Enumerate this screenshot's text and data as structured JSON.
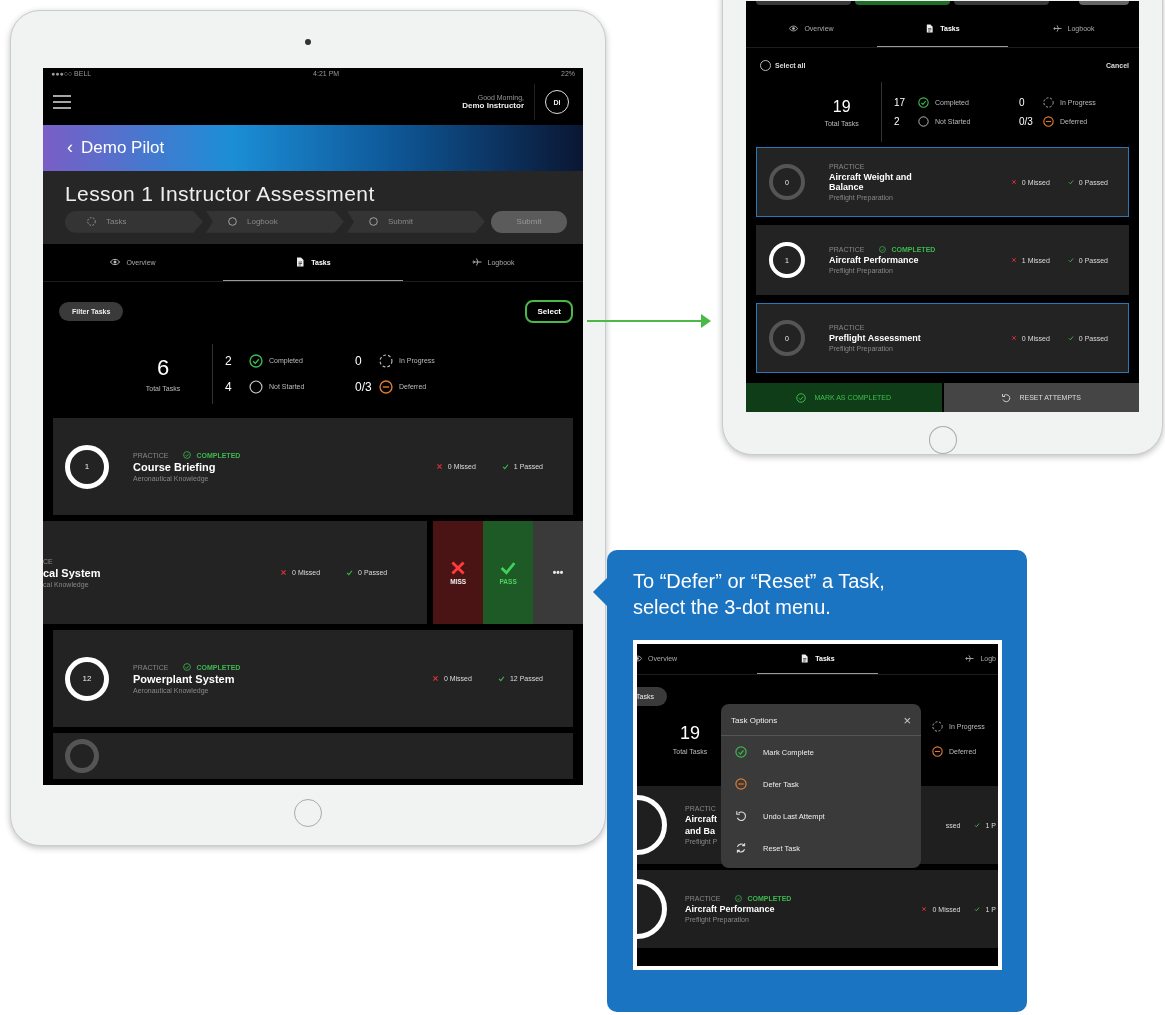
{
  "main_device": {
    "status_bar": {
      "carrier": "●●●○○ BELL",
      "time": "4:21 PM",
      "battery": "22%"
    },
    "header": {
      "greeting": "Good Morning,",
      "user": "Demo Instructor",
      "avatar": "DI"
    },
    "banner": {
      "back": "‹",
      "title": "Demo Pilot"
    },
    "lesson": {
      "title": "Lesson 1 Instructor Assessment",
      "steps": [
        {
          "label": "Tasks",
          "kind": "progress"
        },
        {
          "label": "Logbook",
          "kind": "not_started"
        },
        {
          "label": "Submit",
          "kind": "not_started"
        }
      ],
      "submit": {
        "label": "Submit",
        "disabled": true
      }
    },
    "tabs": [
      {
        "label": "Overview",
        "selected": false
      },
      {
        "label": "Tasks",
        "selected": true
      },
      {
        "label": "Logbook",
        "selected": false
      }
    ],
    "filter_button": "Filter Tasks",
    "select_button": "Select",
    "summary": {
      "total": "6",
      "total_label": "Total Tasks",
      "stats": [
        {
          "count": "2",
          "label": "Completed",
          "kind": "completed"
        },
        {
          "count": "0",
          "label": "In Progress",
          "kind": "progress"
        },
        {
          "count": "4",
          "label": "Not Started",
          "kind": "not_started"
        },
        {
          "count": "0/3",
          "label": "Deferred",
          "kind": "deferred"
        }
      ]
    },
    "tasks": [
      {
        "kind": "card",
        "count": "1",
        "completed": true,
        "type": "PRACTICE",
        "status": "COMPLETED",
        "name": "Course Briefing",
        "category": "Aeronautical Knowledge",
        "missed": "0 Missed",
        "passed": "1 Passed"
      },
      {
        "kind": "swiped",
        "type": "CE",
        "name": "cal System",
        "category": "cal Knowledge",
        "missed": "0 Missed",
        "passed": "0 Passed",
        "actions": [
          {
            "kind": "miss",
            "label": "MISS"
          },
          {
            "kind": "pass",
            "label": "PASS"
          },
          {
            "kind": "more",
            "label": "•••"
          }
        ]
      },
      {
        "kind": "card",
        "count": "12",
        "completed": true,
        "type": "PRACTICE",
        "status": "COMPLETED",
        "name": "Powerplant System",
        "category": "Aeronautical Knowledge",
        "missed": "0 Missed",
        "passed": "12 Passed"
      },
      {
        "kind": "partial",
        "completed": false
      }
    ]
  },
  "select_device": {
    "tabs": [
      {
        "label": "Overview",
        "selected": false
      },
      {
        "label": "Tasks",
        "selected": true
      },
      {
        "label": "Logbook",
        "selected": false
      }
    ],
    "select_all": {
      "label": "Select all",
      "checked": false
    },
    "cancel": "Cancel",
    "summary": {
      "total": "19",
      "total_label": "Total Tasks",
      "stats": [
        {
          "count": "17",
          "label": "Completed",
          "kind": "completed"
        },
        {
          "count": "0",
          "label": "In Progress",
          "kind": "progress"
        },
        {
          "count": "2",
          "label": "Not Started",
          "kind": "not_started"
        },
        {
          "count": "0/3",
          "label": "Deferred",
          "kind": "deferred"
        }
      ]
    },
    "tasks": [
      {
        "count": "0",
        "completed": false,
        "selected": true,
        "type": "PRACTICE",
        "name": "Aircraft Weight and Balance",
        "category": "Preflight Preparation",
        "missed": "0 Missed",
        "passed": "0 Passed"
      },
      {
        "count": "1",
        "completed": true,
        "selected": false,
        "type": "PRACTICE",
        "status": "COMPLETED",
        "name": "Aircraft Performance",
        "category": "Preflight Preparation",
        "missed": "1 Missed",
        "passed": "0 Passed"
      },
      {
        "count": "0",
        "completed": false,
        "selected": true,
        "type": "PRACTICE",
        "name": "Preflight Assessment",
        "category": "Preflight Preparation",
        "missed": "0 Missed",
        "passed": "0 Passed"
      }
    ],
    "actions": [
      {
        "kind": "complete",
        "label": "MARK AS COMPLETED"
      },
      {
        "kind": "reset",
        "label": "RESET ATTEMPTS"
      }
    ]
  },
  "callout": {
    "text": "To “Defer” or “Reset” a Task, select the 3-dot menu.",
    "inset": {
      "tabs": [
        {
          "label": "Overview",
          "selected": false
        },
        {
          "label": "Tasks",
          "selected": true
        },
        {
          "label": "Logb",
          "selected": false
        }
      ],
      "filter_button": "Tasks",
      "total": "19",
      "total_label": "Total Tasks",
      "stats": [
        {
          "label": "In Progress",
          "kind": "progress"
        },
        {
          "label": "Deferred",
          "kind": "deferred"
        }
      ],
      "tasks": [
        {
          "type": "PRACTIC",
          "name_lines": [
            "Aircraft",
            "and Ba"
          ],
          "category": "Preflight P",
          "missed": "ssed",
          "passed": "1 P"
        },
        {
          "type": "PRACTICE",
          "status": "COMPLETED",
          "name_lines": [
            "Aircraft Performance"
          ],
          "category": "Preflight Preparation",
          "missed": "0 Missed",
          "passed": "1 P"
        }
      ],
      "menu": {
        "title": "Task Options",
        "close": "×",
        "items": [
          {
            "kind": "completed",
            "label": "Mark Complete"
          },
          {
            "kind": "deferred",
            "label": "Defer Task"
          },
          {
            "kind": "undo",
            "label": "Undo Last Attempt"
          },
          {
            "kind": "reset",
            "label": "Reset Task"
          }
        ]
      }
    }
  }
}
